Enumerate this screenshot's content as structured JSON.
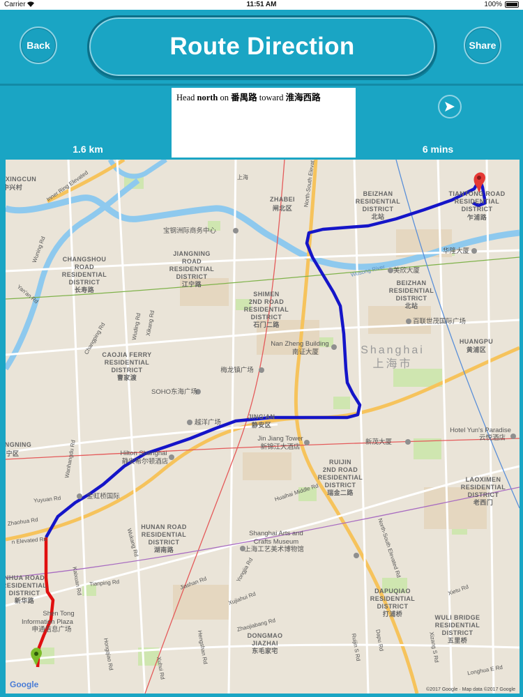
{
  "status_bar": {
    "carrier": "Carrier",
    "time": "11:51 AM",
    "battery": "100%"
  },
  "header": {
    "back_label": "Back",
    "title": "Route Direction",
    "share_label": "Share"
  },
  "route": {
    "distance": "1.6 km",
    "duration": "6 mins",
    "instruction": {
      "prefix": "Head ",
      "direction": "north",
      "mid": " on ",
      "street": "番禺路",
      "toward": " toward ",
      "destination": "淮海西路"
    }
  },
  "map": {
    "labels": {
      "zhabei": "ZHABEI",
      "zhabei_cn": "闸北区",
      "beizhan1": "BEIZHAN",
      "beizhan1b": "RESIDENTIAL",
      "beizhan1c": "DISTRICT",
      "beizhan1_cn": "北站",
      "tiantong1": "TIANTONG ROAD",
      "tiantong2": "RESIDENTIAL",
      "tiantong3": "DISTRICT",
      "tiantong_cn": "乍浦路",
      "beizhan2": "BEIZHAN",
      "beizhan2b": "RESIDENTIAL",
      "beizhan2c": "DISTRICT",
      "beizhan2_cn": "北站",
      "jiangning1": "JIANGNING",
      "jiangning2": "ROAD",
      "jiangning3": "RESIDENTIAL",
      "jiangning4": "DISTRICT",
      "jiangning_cn": "江宁路",
      "changshou1": "CHANGSHOU",
      "changshou2": "ROAD",
      "changshou3": "RESIDENTIAL",
      "changshou4": "DISTRICT",
      "changshou_cn": "长寿路",
      "shimen1": "SHIMEN",
      "shimen2": "2ND ROAD",
      "shimen3": "RESIDENTIAL",
      "shimen4": "DISTRICT",
      "shimen_cn": "石门二路",
      "caojia1": "CAOJIA FERRY",
      "caojia2": "RESIDENTIAL",
      "caojia3": "DISTRICT",
      "caojia_cn": "曹家渡",
      "huangpu": "HUANGPU",
      "huangpu_cn": "黄浦区",
      "shanghai": "Shanghai",
      "shanghai_cn": "上海市",
      "jingan": "JING'AN",
      "jingan_cn": "静安区",
      "ruijin1": "RUIJIN",
      "ruijin2": "2ND ROAD",
      "ruijin3": "RESIDENTIAL",
      "ruijin4": "DISTRICT",
      "ruijin_cn": "瑞金二路",
      "laoximen1": "LAOXIMEN",
      "laoximen2": "RESIDENTIAL",
      "laoximen3": "DISTRICT",
      "laoximen_cn": "老西门",
      "hunan1": "HUNAN ROAD",
      "hunan2": "RESIDENTIAL",
      "hunan3": "DISTRICT",
      "hunan_cn": "湖南路",
      "dapuqiao1": "DAPUQIAO",
      "dapuqiao2": "RESIDENTIAL",
      "dapuqiao3": "DISTRICT",
      "dapuqiao_cn": "打浦桥",
      "wuli1": "WULI BRIDGE",
      "wuli2": "RESIDENTIAL",
      "wuli3": "DISTRICT",
      "wuli_cn": "五里桥",
      "dongmiao1": "DONGMAO",
      "dongmiao2": "JIAZHAI",
      "dongmiao_cn": "东毛家宅",
      "xingcun": "XINGCUN",
      "xingcun_cn": "中兴村",
      "ningning": "NGNING",
      "ningning_cn": "宁区",
      "xinhua1": "NHUA ROAD",
      "xinhua2": "RESIDENTIAL",
      "xinhua3": "DISTRICT",
      "xinhua_cn": "新华路",
      "nanzheng": "Nan Zheng Building",
      "nanzheng_cn": "南证大厦",
      "baoneng": "宝钢洲际商务中心",
      "huaxin": "华隆大厦",
      "meixin": "美欣大厦",
      "bailian": "百联世茂国际广场",
      "meilong": "梅龙镇广场",
      "soho": "SOHO东海广场",
      "yueyang": "越洋广场",
      "jinjiang": "Jin Jiang Tower",
      "jinjiang_cn": "新锦江大酒店",
      "xinmao": "新茂大厦",
      "hilton": "Hilton Shanghai",
      "hilton_cn": "静安希尔顿酒店",
      "yuxin": "金虹桥国际",
      "hotelyun": "Hotel Yun's Paradise",
      "hotelyun_cn": "云悦酒店",
      "arts1": "Shanghai Arts and",
      "arts2": "Crafts Museum",
      "arts_cn": "上海工艺美术博物馆",
      "shentong1": "Shen Tong",
      "shentong2": "Information Plaza",
      "shentong_cn": "申通信息广场",
      "wusong": "Wusong River",
      "innering": "Inner Ring Elevated",
      "elevated": "n Elevated Rd",
      "huaihai": "Huaihai Middle Rd",
      "nsroad_top": "North-South Elevat",
      "nsroad_bottom": "North-South Elevated Rd",
      "zhaohua": "Zhaohua Rd",
      "yuyuan": "Yuyuan Rd",
      "wuning": "Wuning Rd",
      "wuding": "Wuding Rd",
      "changping": "Changping Rd",
      "wanhangdu": "Wanhangdu Rd",
      "xikang": "Xikang Rd",
      "yanan": "Yan'an Rd",
      "kaixuan": "Kaixuan Rd",
      "hengshan": "Hengshan Rd",
      "tianping": "Tianping Rd",
      "wukang": "Wukang Rd",
      "jiashan": "Jiashan Rd",
      "xujiahui": "Xujiahui Rd",
      "zhaojiabang": "Zhaojiabang Rd",
      "yongjia": "Yongjia Rd",
      "ruijin_rd": "Ruijin S Rd",
      "dapu": "Dapu Rd",
      "xizang": "Xizang S Rd",
      "xietu": "Xietu Rd",
      "longhua": "Longhua E Rd",
      "xuhui": "Xuhui Rd",
      "hongqiao": "Hongqiao Rd",
      "shangcheng": "上海",
      "google": "Google",
      "attribution": "©2017 Google · Map data ©2017 Google"
    }
  }
}
